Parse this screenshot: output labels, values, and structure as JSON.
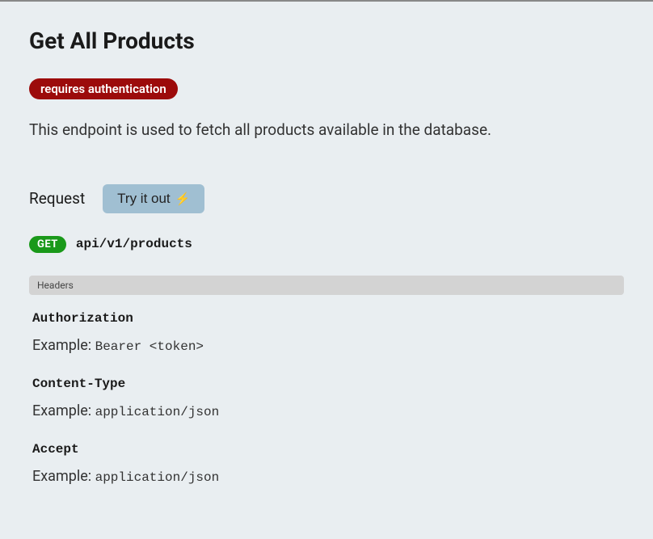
{
  "title": "Get All Products",
  "authBadge": "requires authentication",
  "description": "This endpoint is used to fetch all products available in the database.",
  "request": {
    "label": "Request",
    "tryButton": "Try it out",
    "method": "GET",
    "path": "api/v1/products"
  },
  "headersSection": {
    "label": "Headers",
    "exampleLabel": "Example:",
    "items": [
      {
        "name": "Authorization",
        "example": "Bearer <token>"
      },
      {
        "name": "Content-Type",
        "example": "application/json"
      },
      {
        "name": "Accept",
        "example": "application/json"
      }
    ]
  }
}
